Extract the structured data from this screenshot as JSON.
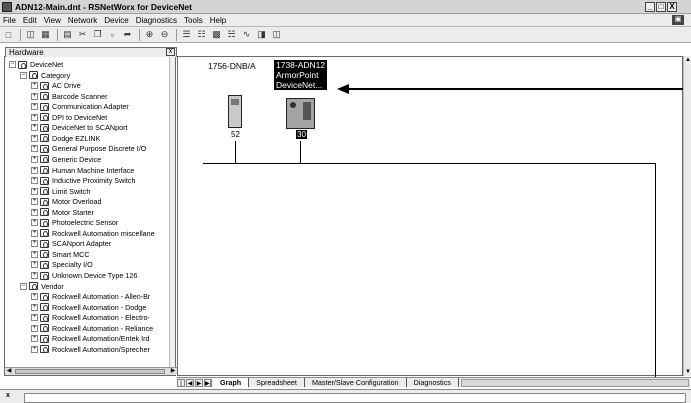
{
  "window": {
    "title": "ADN12-Main.dnt - RSNetWorx for DeviceNet",
    "controls": [
      "_",
      "□",
      "X"
    ]
  },
  "menu": {
    "items": [
      "File",
      "Edit",
      "View",
      "Network",
      "Device",
      "Diagnostics",
      "Tools",
      "Help"
    ]
  },
  "toolbar": {
    "icons": [
      "new-icon",
      "open-icon",
      "save-icon",
      "print-icon",
      "cut-icon",
      "copy-icon",
      "paste-icon",
      "help-pointer-icon",
      "zoom-in-icon",
      "zoom-out-icon",
      "single-pass-browse-icon",
      "continuous-browse-icon",
      "upload-icon",
      "online-icon",
      "graph-icon",
      "properties-icon",
      "wizard-icon"
    ]
  },
  "hardware_panel": {
    "title": "Hardware",
    "tree": [
      {
        "label": "DeviceNet",
        "level": 0,
        "expanded": true
      },
      {
        "label": "Category",
        "level": 1,
        "expanded": true
      },
      {
        "label": "AC Drive",
        "level": 2
      },
      {
        "label": "Barcode Scanner",
        "level": 2
      },
      {
        "label": "Communication Adapter",
        "level": 2
      },
      {
        "label": "DPI to DeviceNet",
        "level": 2
      },
      {
        "label": "DeviceNet to SCANport",
        "level": 2
      },
      {
        "label": "Dodge EZLINK",
        "level": 2
      },
      {
        "label": "General Purpose Discrete I/O",
        "level": 2
      },
      {
        "label": "Generic Device",
        "level": 2
      },
      {
        "label": "Human Machine Interface",
        "level": 2
      },
      {
        "label": "Inductive Proximity Switch",
        "level": 2
      },
      {
        "label": "Limit Switch",
        "level": 2
      },
      {
        "label": "Motor Overload",
        "level": 2
      },
      {
        "label": "Motor Starter",
        "level": 2
      },
      {
        "label": "Photoelectric Sensor",
        "level": 2
      },
      {
        "label": "Rockwell Automation miscellane",
        "level": 2
      },
      {
        "label": "SCANport Adapter",
        "level": 2
      },
      {
        "label": "Smart MCC",
        "level": 2
      },
      {
        "label": "Specialty I/O",
        "level": 2
      },
      {
        "label": "Unknown Device Type 126",
        "level": 2
      },
      {
        "label": "Vendor",
        "level": 1,
        "expanded": true
      },
      {
        "label": "Rockwell Automation - Allen-Br",
        "level": 2
      },
      {
        "label": "Rockwell Automation - Dodge",
        "level": 2
      },
      {
        "label": "Rockwell Automation - Electro-",
        "level": 2
      },
      {
        "label": "Rockwell Automation - Reliance",
        "level": 2
      },
      {
        "label": "Rockwell Automation/Entek Ird",
        "level": 2
      },
      {
        "label": "Rockwell Automation/Sprecher",
        "level": 2
      }
    ]
  },
  "graph": {
    "devices": [
      {
        "name": "1756-DNB/A",
        "node": "52",
        "selected": false
      },
      {
        "name": "1738-ADN12\nArmorPoint\nDeviceNet...",
        "node": "30",
        "selected": true
      }
    ]
  },
  "tabs": {
    "items": [
      "Graph",
      "Spreadsheet",
      "Master/Slave Configuration",
      "Diagnostics"
    ],
    "active": "Graph"
  },
  "statusbar": {
    "close_glyph": "x"
  }
}
